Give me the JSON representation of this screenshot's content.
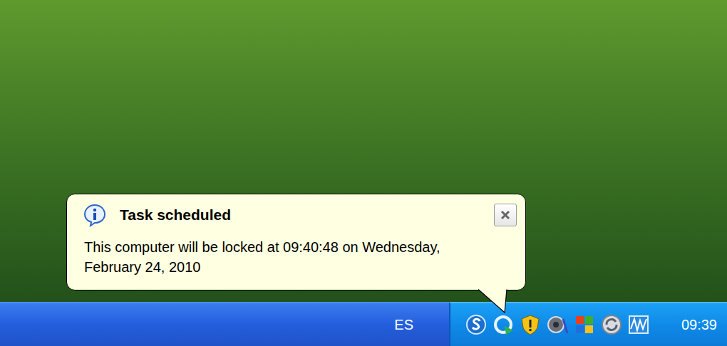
{
  "balloon": {
    "title": "Task scheduled",
    "message": "This computer will be locked at 09:40:48 on Wednesday, February 24, 2010"
  },
  "taskbar": {
    "language": "ES",
    "clock": "09:39"
  }
}
